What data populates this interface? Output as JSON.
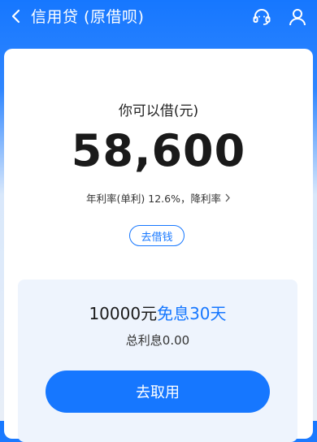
{
  "header": {
    "title": "信用贷 (原借呗)",
    "back_icon": "chevron-left-icon",
    "support_icon": "headset-icon",
    "user_icon": "user-icon"
  },
  "loan": {
    "label": "你可以借(元)",
    "amount": "58,600",
    "rate_text": "年利率(单利) 12.6%，降利率",
    "borrow_button": "去借钱"
  },
  "promo": {
    "amount_text": "10000元",
    "highlight_text": "免息30天",
    "interest_text": "总利息0.00",
    "action_button": "去取用"
  },
  "colors": {
    "primary": "#1677ff",
    "text": "#1a1a1a",
    "promo_bg": "#eef4fd"
  }
}
